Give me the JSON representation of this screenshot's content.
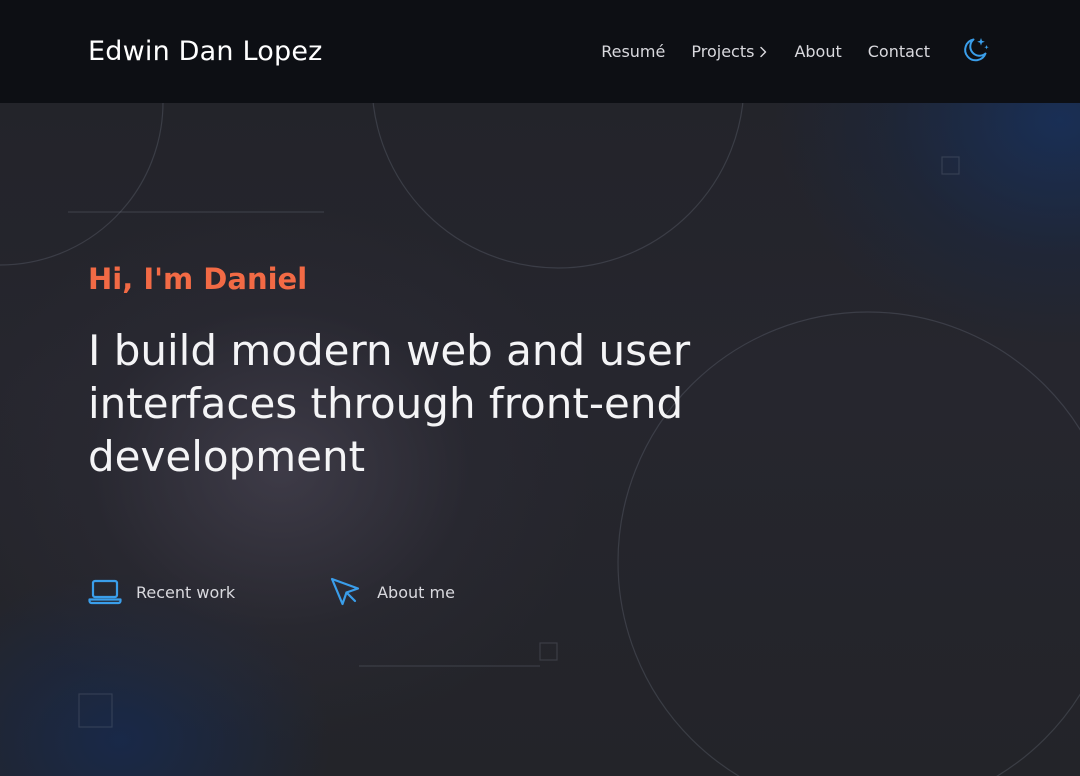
{
  "header": {
    "brand": "Edwin Dan Lopez",
    "nav": [
      {
        "label": "Resumé"
      },
      {
        "label": "Projects",
        "has_submenu": true
      },
      {
        "label": "About"
      },
      {
        "label": "Contact"
      }
    ],
    "theme_toggle_icon": "moon-stars-icon"
  },
  "hero": {
    "greeting": "Hi, I'm Daniel",
    "headline": "I build modern web and user interfaces through front-end development"
  },
  "ctas": [
    {
      "label": "Recent work",
      "icon": "laptop-icon"
    },
    {
      "label": "About me",
      "icon": "cursor-icon"
    }
  ],
  "colors": {
    "accent": "#f26a45",
    "icon_blue": "#3a9eea",
    "header_bg": "#0d0f14",
    "body_bg": "#222329"
  }
}
